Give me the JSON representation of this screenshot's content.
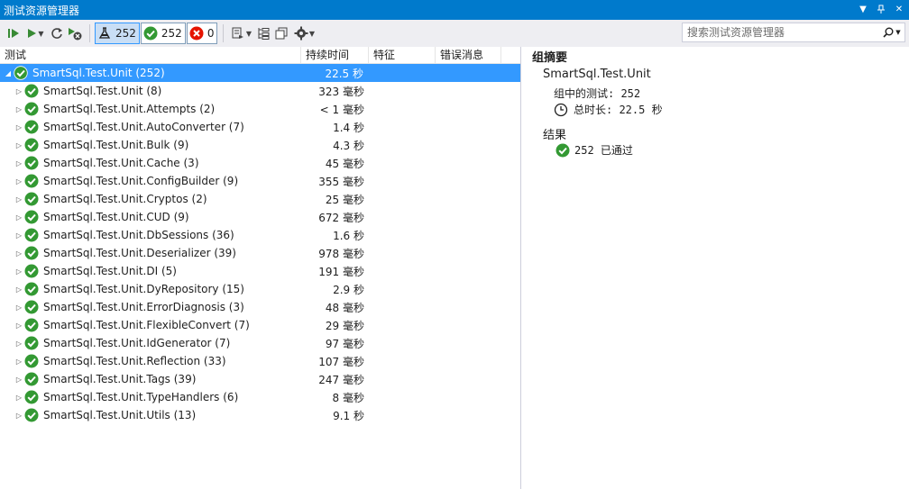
{
  "window": {
    "title": "测试资源管理器"
  },
  "toolbar": {
    "counts": {
      "total": "252",
      "passed": "252",
      "failed": "0"
    },
    "search_placeholder": "搜索测试资源管理器"
  },
  "columns": [
    "测试",
    "持续时间",
    "特征",
    "错误消息"
  ],
  "tree": {
    "root": {
      "name": "SmartSql.Test.Unit (252)",
      "duration": "22.5 秒"
    },
    "children": [
      {
        "name": "SmartSql.Test.Unit (8)",
        "duration": "323 毫秒"
      },
      {
        "name": "SmartSql.Test.Unit.Attempts (2)",
        "duration": "< 1 毫秒"
      },
      {
        "name": "SmartSql.Test.Unit.AutoConverter (7)",
        "duration": "1.4 秒"
      },
      {
        "name": "SmartSql.Test.Unit.Bulk (9)",
        "duration": "4.3 秒"
      },
      {
        "name": "SmartSql.Test.Unit.Cache (3)",
        "duration": "45 毫秒"
      },
      {
        "name": "SmartSql.Test.Unit.ConfigBuilder (9)",
        "duration": "355 毫秒"
      },
      {
        "name": "SmartSql.Test.Unit.Cryptos (2)",
        "duration": "25 毫秒"
      },
      {
        "name": "SmartSql.Test.Unit.CUD (9)",
        "duration": "672 毫秒"
      },
      {
        "name": "SmartSql.Test.Unit.DbSessions (36)",
        "duration": "1.6 秒"
      },
      {
        "name": "SmartSql.Test.Unit.Deserializer (39)",
        "duration": "978 毫秒"
      },
      {
        "name": "SmartSql.Test.Unit.DI (5)",
        "duration": "191 毫秒"
      },
      {
        "name": "SmartSql.Test.Unit.DyRepository (15)",
        "duration": "2.9 秒"
      },
      {
        "name": "SmartSql.Test.Unit.ErrorDiagnosis (3)",
        "duration": "48 毫秒"
      },
      {
        "name": "SmartSql.Test.Unit.FlexibleConvert (7)",
        "duration": "29 毫秒"
      },
      {
        "name": "SmartSql.Test.Unit.IdGenerator (7)",
        "duration": "97 毫秒"
      },
      {
        "name": "SmartSql.Test.Unit.Reflection (33)",
        "duration": "107 毫秒"
      },
      {
        "name": "SmartSql.Test.Unit.Tags (39)",
        "duration": "247 毫秒"
      },
      {
        "name": "SmartSql.Test.Unit.TypeHandlers (6)",
        "duration": "8 毫秒"
      },
      {
        "name": "SmartSql.Test.Unit.Utils (13)",
        "duration": "9.1 秒"
      }
    ]
  },
  "summary": {
    "title": "组摘要",
    "group_name": "SmartSql.Test.Unit",
    "tests_in_group": "组中的测试: 252",
    "total_duration": "总时长: 22.5 秒",
    "results_heading": "结果",
    "passed_text": "252 已通过"
  },
  "colors": {
    "accent": "#007acc",
    "selection": "#3399ff",
    "pass": "#339933",
    "fail": "#e51400"
  },
  "icons": [
    "run-all-icon",
    "run-icon",
    "refresh-icon",
    "cancel-icon",
    "flask-icon",
    "check-circle-icon",
    "x-circle-icon",
    "playlist-icon",
    "group-by-icon",
    "copy-icon",
    "settings-icon",
    "search-icon",
    "clock-icon"
  ]
}
